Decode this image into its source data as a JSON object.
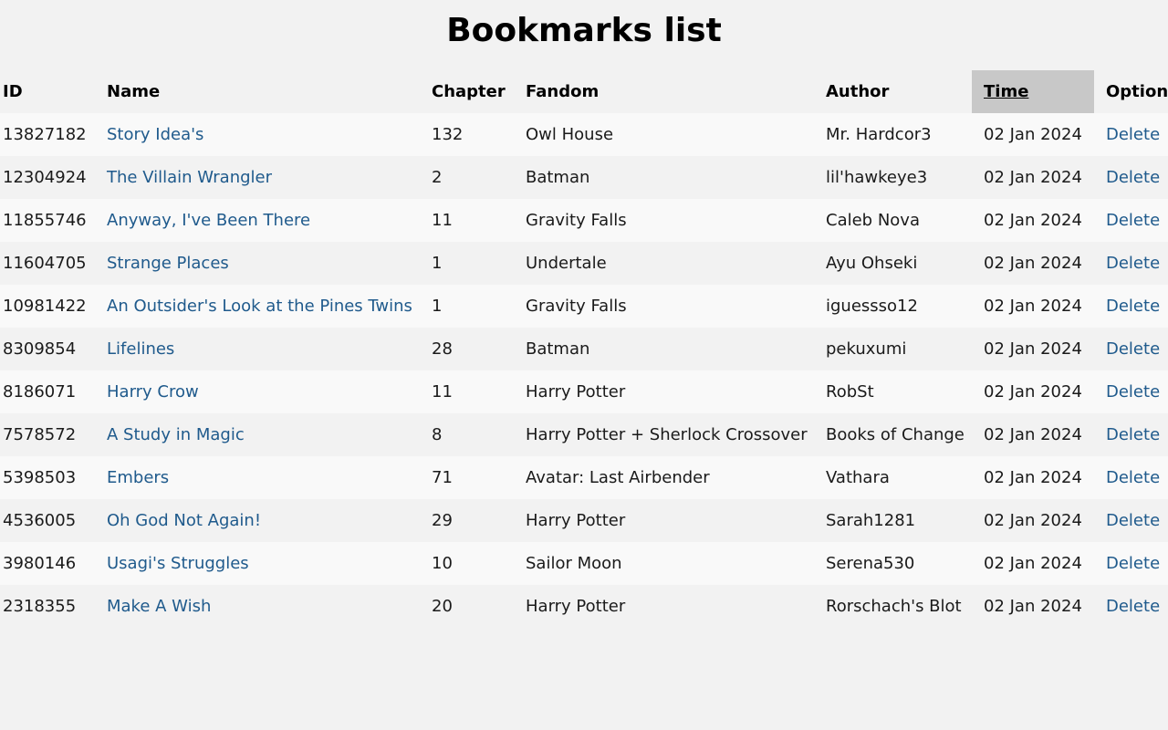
{
  "page": {
    "title": "Bookmarks list"
  },
  "table": {
    "headers": {
      "id": "ID",
      "name": "Name",
      "chapter": "Chapter",
      "fandom": "Fandom",
      "author": "Author",
      "time": "Time",
      "options": "Options"
    },
    "sorted_by": "Time",
    "rows": [
      {
        "id": "13827182",
        "name": "Story Idea's",
        "chapter": "132",
        "fandom": "Owl House",
        "author": "Mr. Hardcor3",
        "time": "02 Jan 2024",
        "option": "Delete"
      },
      {
        "id": "12304924",
        "name": "The Villain Wrangler",
        "chapter": "2",
        "fandom": "Batman",
        "author": "lil'hawkeye3",
        "time": "02 Jan 2024",
        "option": "Delete"
      },
      {
        "id": "11855746",
        "name": "Anyway, I've Been There",
        "chapter": "11",
        "fandom": "Gravity Falls",
        "author": "Caleb Nova",
        "time": "02 Jan 2024",
        "option": "Delete"
      },
      {
        "id": "11604705",
        "name": "Strange Places",
        "chapter": "1",
        "fandom": "Undertale",
        "author": "Ayu Ohseki",
        "time": "02 Jan 2024",
        "option": "Delete"
      },
      {
        "id": "10981422",
        "name": "An Outsider's Look at the Pines Twins",
        "chapter": "1",
        "fandom": "Gravity Falls",
        "author": "iguessso12",
        "time": "02 Jan 2024",
        "option": "Delete"
      },
      {
        "id": "8309854",
        "name": "Lifelines",
        "chapter": "28",
        "fandom": "Batman",
        "author": "pekuxumi",
        "time": "02 Jan 2024",
        "option": "Delete"
      },
      {
        "id": "8186071",
        "name": "Harry Crow",
        "chapter": "11",
        "fandom": "Harry Potter",
        "author": "RobSt",
        "time": "02 Jan 2024",
        "option": "Delete"
      },
      {
        "id": "7578572",
        "name": "A Study in Magic",
        "chapter": "8",
        "fandom": "Harry Potter + Sherlock Crossover",
        "author": "Books of Change",
        "time": "02 Jan 2024",
        "option": "Delete"
      },
      {
        "id": "5398503",
        "name": "Embers",
        "chapter": "71",
        "fandom": "Avatar: Last Airbender",
        "author": "Vathara",
        "time": "02 Jan 2024",
        "option": "Delete"
      },
      {
        "id": "4536005",
        "name": "Oh God Not Again!",
        "chapter": "29",
        "fandom": "Harry Potter",
        "author": "Sarah1281",
        "time": "02 Jan 2024",
        "option": "Delete"
      },
      {
        "id": "3980146",
        "name": "Usagi's Struggles",
        "chapter": "10",
        "fandom": "Sailor Moon",
        "author": "Serena530",
        "time": "02 Jan 2024",
        "option": "Delete"
      },
      {
        "id": "2318355",
        "name": "Make A Wish",
        "chapter": "20",
        "fandom": "Harry Potter",
        "author": "Rorschach's Blot",
        "time": "02 Jan 2024",
        "option": "Delete"
      }
    ]
  },
  "colors": {
    "background": "#f2f2f2",
    "row_alt": "#f9f9f9",
    "sorted_header_bg": "#c8c8c8",
    "link": "#1f5a8c"
  }
}
